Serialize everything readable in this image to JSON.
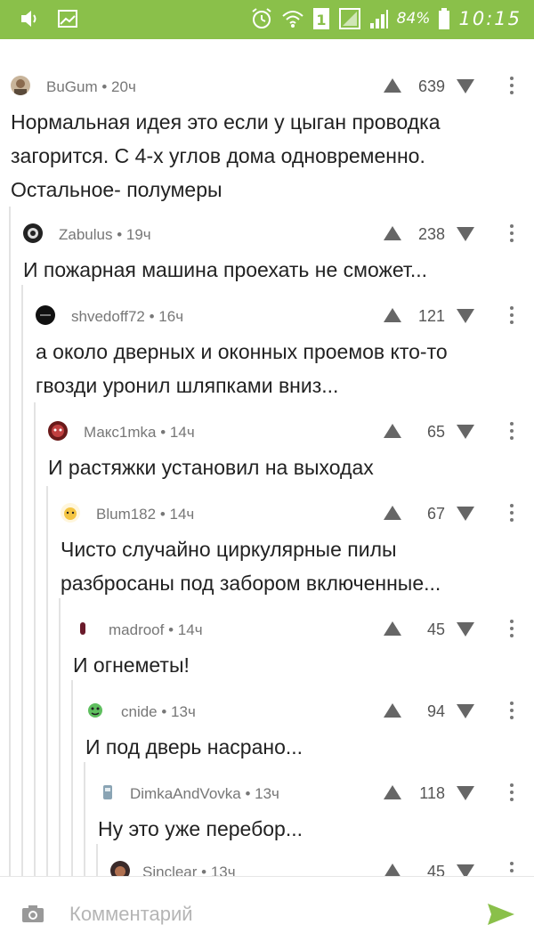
{
  "status_bar": {
    "icons": [
      "volume-icon",
      "gallery-icon",
      "alarm-icon",
      "wifi-icon",
      "sim1-icon",
      "signal-icon",
      "signal-strength-icon",
      "battery-icon"
    ],
    "battery": "84%",
    "time": "10:15",
    "bg_color": "#8ac04a"
  },
  "comments": [
    {
      "author": "BuGum",
      "time": "20ч",
      "rating": "639",
      "lines": [
        "Нормальная идея это если у цыган проводка",
        "загорится. С 4-х углов дома одновременно.",
        "Остальное- полумеры"
      ]
    },
    {
      "author": "Zabulus",
      "time": "19ч",
      "rating": "238",
      "lines": [
        "И пожарная машина проехать не сможет..."
      ]
    },
    {
      "author": "shvedoff72",
      "time": "16ч",
      "rating": "121",
      "lines": [
        "а около дверных и оконных проемов кто-то",
        "гвозди уронил шляпками вниз..."
      ]
    },
    {
      "author": "Макс1mka",
      "time": "14ч",
      "rating": "65",
      "lines": [
        "И растяжки установил на выходах"
      ]
    },
    {
      "author": "Blum182",
      "time": "14ч",
      "rating": "67",
      "lines": [
        "Чисто случайно циркулярные пилы",
        "разбросаны под забором включенные..."
      ]
    },
    {
      "author": "madroof",
      "time": "14ч",
      "rating": "45",
      "lines": [
        "И огнеметы!"
      ]
    },
    {
      "author": "cnide",
      "time": "13ч",
      "rating": "94",
      "lines": [
        "И под дверь насрано..."
      ]
    },
    {
      "author": "DimkaAndVovka",
      "time": "13ч",
      "rating": "118",
      "lines": [
        "Ну это уже перебор..."
      ]
    },
    {
      "author": "Sinclear",
      "time": "13ч",
      "rating": "45",
      "lines": []
    }
  ],
  "bottom_bar": {
    "placeholder": "Комментарий",
    "send_color": "#8ac04a"
  },
  "colors": {
    "accent": "#8ac04a",
    "thread_line": "#e3e3e3",
    "meta_text": "#777777"
  }
}
